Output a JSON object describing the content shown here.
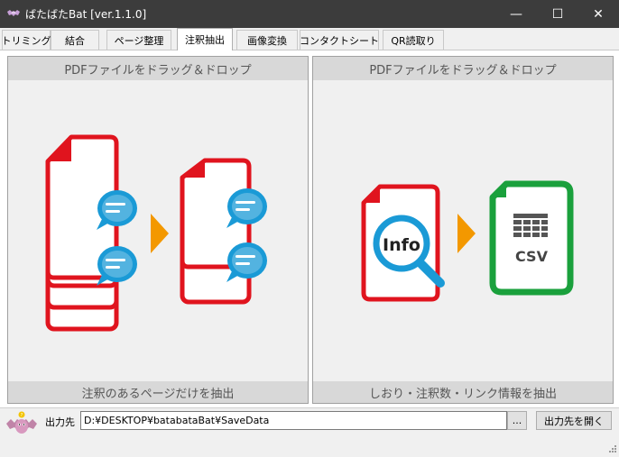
{
  "window": {
    "title": "ばたばたBat [ver.1.1.0]",
    "minimize_label": "—",
    "maximize_label": "☐",
    "close_label": "✕"
  },
  "tabs": [
    {
      "label": "トリミング"
    },
    {
      "label": "結合"
    },
    {
      "label": "ページ整理"
    },
    {
      "label": "注釈抽出",
      "active": true
    },
    {
      "label": "画像変換"
    },
    {
      "label": "コンタクトシート"
    },
    {
      "label": "QR読取り"
    }
  ],
  "panels": {
    "left": {
      "header": "PDFファイルをドラッグ＆ドロップ",
      "footer": "注釈のあるページだけを抽出"
    },
    "right": {
      "header": "PDFファイルをドラッグ＆ドロップ",
      "footer": "しおり・注釈数・リンク情報を抽出",
      "info_text": "Info",
      "csv_text": "CSV"
    }
  },
  "output": {
    "label": "出力先",
    "path": "D:¥DESKTOP¥batabataBat¥SaveData",
    "browse_label": "...",
    "open_label": "出力先を開く"
  },
  "colors": {
    "pdf_red": "#e0141e",
    "arrow_orange": "#f39800",
    "bubble_blue": "#1a9ad6",
    "csv_green": "#1aa03c",
    "titlebar": "#3c3c3c"
  }
}
